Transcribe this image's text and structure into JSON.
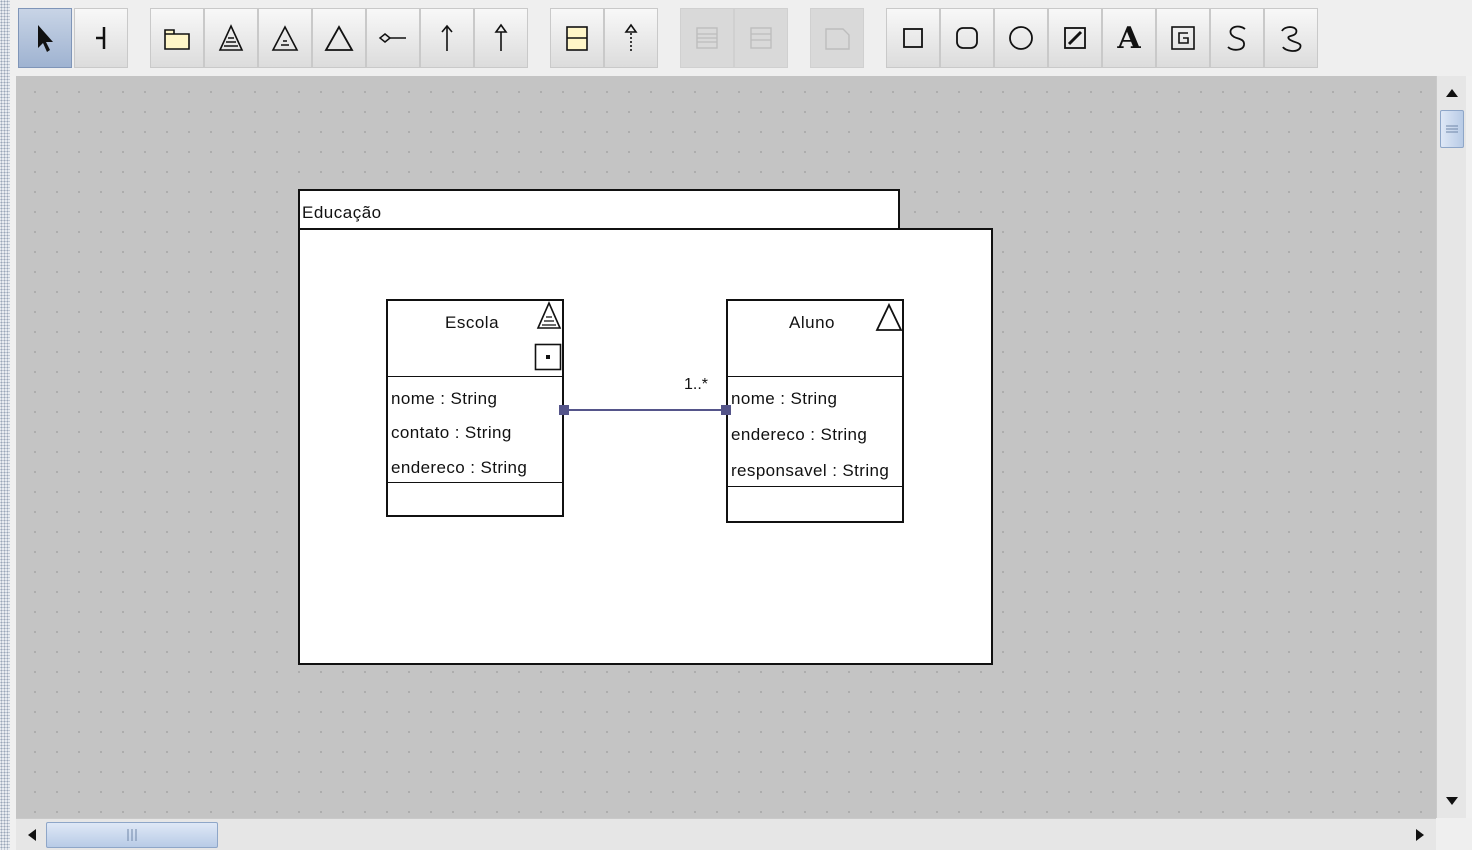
{
  "toolbar": {
    "tools": [
      {
        "name": "select-tool",
        "state": "selected"
      },
      {
        "name": "anchor-tool",
        "state": "normal"
      },
      {
        "name": "package-tool",
        "state": "normal"
      },
      {
        "name": "abstract-class-tool",
        "state": "normal"
      },
      {
        "name": "interface-class-tool",
        "state": "normal"
      },
      {
        "name": "class-tool",
        "state": "normal"
      },
      {
        "name": "aggregation-tool",
        "state": "normal"
      },
      {
        "name": "association-tool",
        "state": "normal"
      },
      {
        "name": "generalization-tool",
        "state": "normal"
      },
      {
        "name": "attribute-compartment-tool",
        "state": "normal"
      },
      {
        "name": "dependency-tool",
        "state": "normal"
      },
      {
        "name": "add-attribute-tool",
        "state": "disabled"
      },
      {
        "name": "add-operation-tool",
        "state": "disabled"
      },
      {
        "name": "note-tool",
        "state": "disabled"
      },
      {
        "name": "rectangle-tool",
        "state": "normal"
      },
      {
        "name": "rounded-rectangle-tool",
        "state": "normal"
      },
      {
        "name": "ellipse-tool",
        "state": "normal"
      },
      {
        "name": "line-tool",
        "state": "normal"
      },
      {
        "name": "text-tool",
        "state": "normal",
        "glyph": "A"
      },
      {
        "name": "image-tool",
        "state": "normal"
      },
      {
        "name": "spline-tool",
        "state": "normal"
      },
      {
        "name": "curve-tool",
        "state": "normal"
      }
    ]
  },
  "diagram": {
    "package": {
      "name": "Educação"
    },
    "classes": [
      {
        "id": "escola",
        "name": "Escola",
        "attributes": [
          "nome : String",
          "contato : String",
          "endereco : String"
        ]
      },
      {
        "id": "aluno",
        "name": "Aluno",
        "attributes": [
          "nome : String",
          "endereco : String",
          "responsavel : String"
        ]
      }
    ],
    "association": {
      "from": "escola",
      "to": "aluno",
      "multiplicity_target": "1..*"
    }
  },
  "colors": {
    "canvas": "#c4c4c4",
    "selection": "#9fb3d1",
    "connector": "#55558a"
  }
}
